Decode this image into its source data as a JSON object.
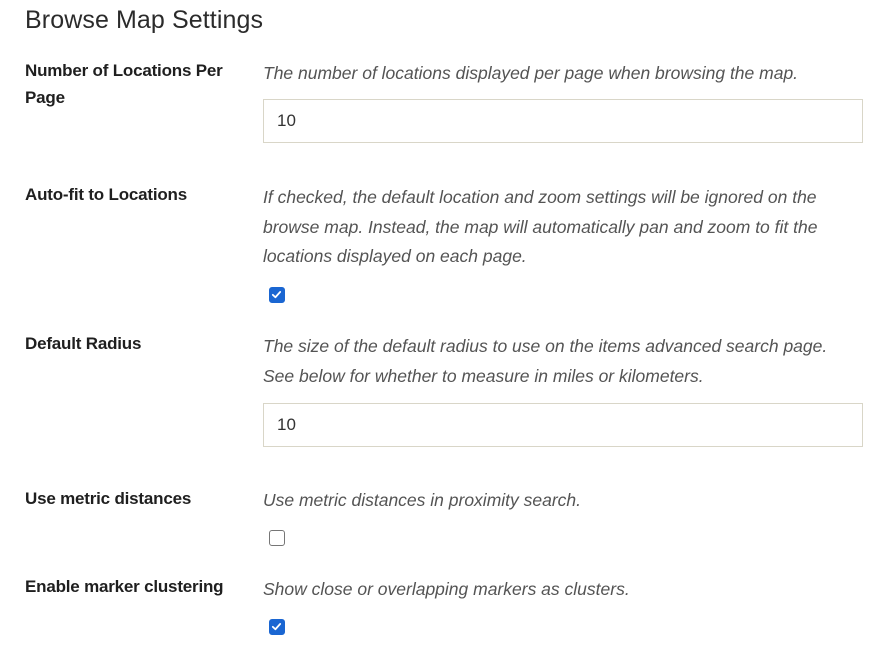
{
  "section": {
    "title": "Browse Map Settings"
  },
  "fields": {
    "per_page": {
      "label": "Number of Locations Per Page",
      "help": "The number of locations displayed per page when browsing the map.",
      "value": "10"
    },
    "auto_fit": {
      "label": "Auto-fit to Locations",
      "help": "If checked, the default location and zoom settings will be ignored on the browse map. Instead, the map will automatically pan and zoom to fit the locations displayed on each page.",
      "checked": true
    },
    "default_radius": {
      "label": "Default Radius",
      "help": "The size of the default radius to use on the items advanced search page. See below for whether to measure in miles or kilometers.",
      "value": "10"
    },
    "use_metric": {
      "label": "Use metric distances",
      "help": "Use metric distances in proximity search.",
      "checked": false
    },
    "marker_clustering": {
      "label": "Enable marker clustering",
      "help": "Show close or overlapping markers as clusters.",
      "checked": true
    }
  },
  "colors": {
    "checkbox_checked": "#1a66d2",
    "input_border": "#d9d6c8",
    "help_text": "#545454"
  },
  "icons": {
    "checkmark": "checkmark-icon"
  }
}
